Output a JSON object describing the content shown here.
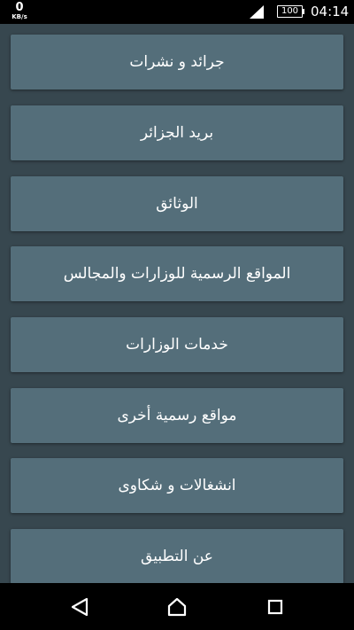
{
  "status_bar": {
    "net_speed_value": "0",
    "net_speed_unit": "KB/s",
    "battery": "100",
    "time": "04:14",
    "icons": [
      "signal-icon",
      "battery-icon"
    ]
  },
  "menu": {
    "items": [
      {
        "label": "جرائد و نشرات"
      },
      {
        "label": "بريد الجزائر"
      },
      {
        "label": "الوثائق"
      },
      {
        "label": "المواقع الرسمية للوزارات والمجالس"
      },
      {
        "label": "خدمات الوزارات"
      },
      {
        "label": "مواقع رسمية أخرى"
      },
      {
        "label": "انشغالات و شكاوى"
      },
      {
        "label": "عن التطبيق"
      }
    ]
  },
  "nav_bar": {
    "icons": [
      "back-icon",
      "home-icon",
      "recent-apps-icon"
    ]
  },
  "colors": {
    "background": "#37474f",
    "item_background": "#546e7a",
    "text": "#ffffff",
    "system_bars": "#000000"
  }
}
